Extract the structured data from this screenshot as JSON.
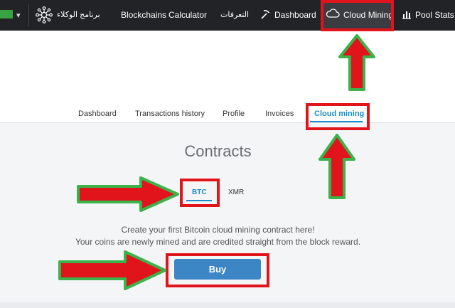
{
  "nav": {
    "affiliate": "برنامج الوكلاء",
    "blockchains": "Blockchains",
    "calculator": "Calculator",
    "arabic_item": "التعرفات",
    "dashboard": "Dashboard",
    "cloud_mining": "Cloud Mining",
    "pool_stats": "Pool Stats"
  },
  "tabs": [
    "Dashboard",
    "Transactions history",
    "Profile",
    "Invoices",
    "Cloud mining"
  ],
  "main": {
    "title": "Contracts",
    "coins": [
      "BTC",
      "XMR"
    ],
    "line1": "Create your first Bitcoin cloud mining contract here!",
    "line2": "Your coins are newly mined and are credited straight from the block reward.",
    "buy": "Buy"
  },
  "colors": {
    "nav_bg": "#222326",
    "accent": "#1a8cc9",
    "button": "#3d86c6",
    "highlight_box": "#e1141c",
    "arrow_fill": "#e1141c",
    "arrow_outline": "#3bb24a"
  }
}
